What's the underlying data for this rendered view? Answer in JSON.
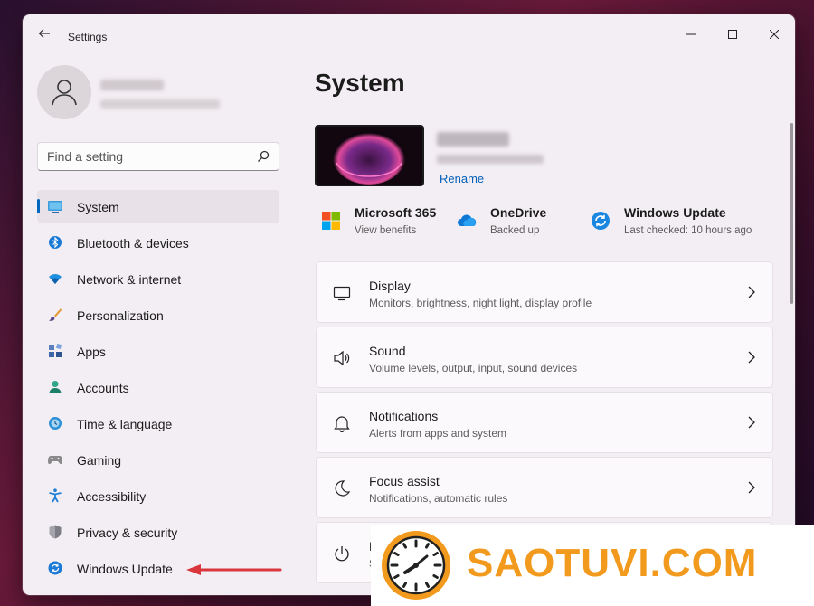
{
  "window": {
    "title": "Settings"
  },
  "sidebar": {
    "search_placeholder": "Find a setting",
    "items": [
      {
        "label": "System",
        "icon": "system-icon",
        "selected": true
      },
      {
        "label": "Bluetooth & devices",
        "icon": "bluetooth-icon"
      },
      {
        "label": "Network & internet",
        "icon": "wifi-icon"
      },
      {
        "label": "Personalization",
        "icon": "brush-icon"
      },
      {
        "label": "Apps",
        "icon": "apps-icon"
      },
      {
        "label": "Accounts",
        "icon": "accounts-icon"
      },
      {
        "label": "Time & language",
        "icon": "time-language-icon"
      },
      {
        "label": "Gaming",
        "icon": "gamepad-icon"
      },
      {
        "label": "Accessibility",
        "icon": "accessibility-icon"
      },
      {
        "label": "Privacy & security",
        "icon": "shield-icon"
      },
      {
        "label": "Windows Update",
        "icon": "windows-update-icon"
      }
    ]
  },
  "main": {
    "title": "System",
    "device": {
      "rename_label": "Rename"
    },
    "quick_links": [
      {
        "title": "Microsoft 365",
        "subtitle": "View benefits",
        "icon": "microsoft-365-icon"
      },
      {
        "title": "OneDrive",
        "subtitle": "Backed up",
        "icon": "onedrive-icon"
      },
      {
        "title": "Windows Update",
        "subtitle": "Last checked: 10 hours ago",
        "icon": "windows-update-icon"
      }
    ],
    "cards": [
      {
        "title": "Display",
        "subtitle": "Monitors, brightness, night light, display profile",
        "icon": "monitor-icon"
      },
      {
        "title": "Sound",
        "subtitle": "Volume levels, output, input, sound devices",
        "icon": "speaker-icon"
      },
      {
        "title": "Notifications",
        "subtitle": "Alerts from apps and system",
        "icon": "bell-icon"
      },
      {
        "title": "Focus assist",
        "subtitle": "Notifications, automatic rules",
        "icon": "moon-icon"
      },
      {
        "title": "P",
        "subtitle": "S",
        "icon": "power-icon"
      }
    ]
  },
  "watermark": {
    "text": "SAOTUVI.COM"
  },
  "colors": {
    "accent": "#0067c0",
    "link": "#005fb8",
    "annotation_arrow": "#d9363e",
    "watermark": "#f29a1e"
  }
}
